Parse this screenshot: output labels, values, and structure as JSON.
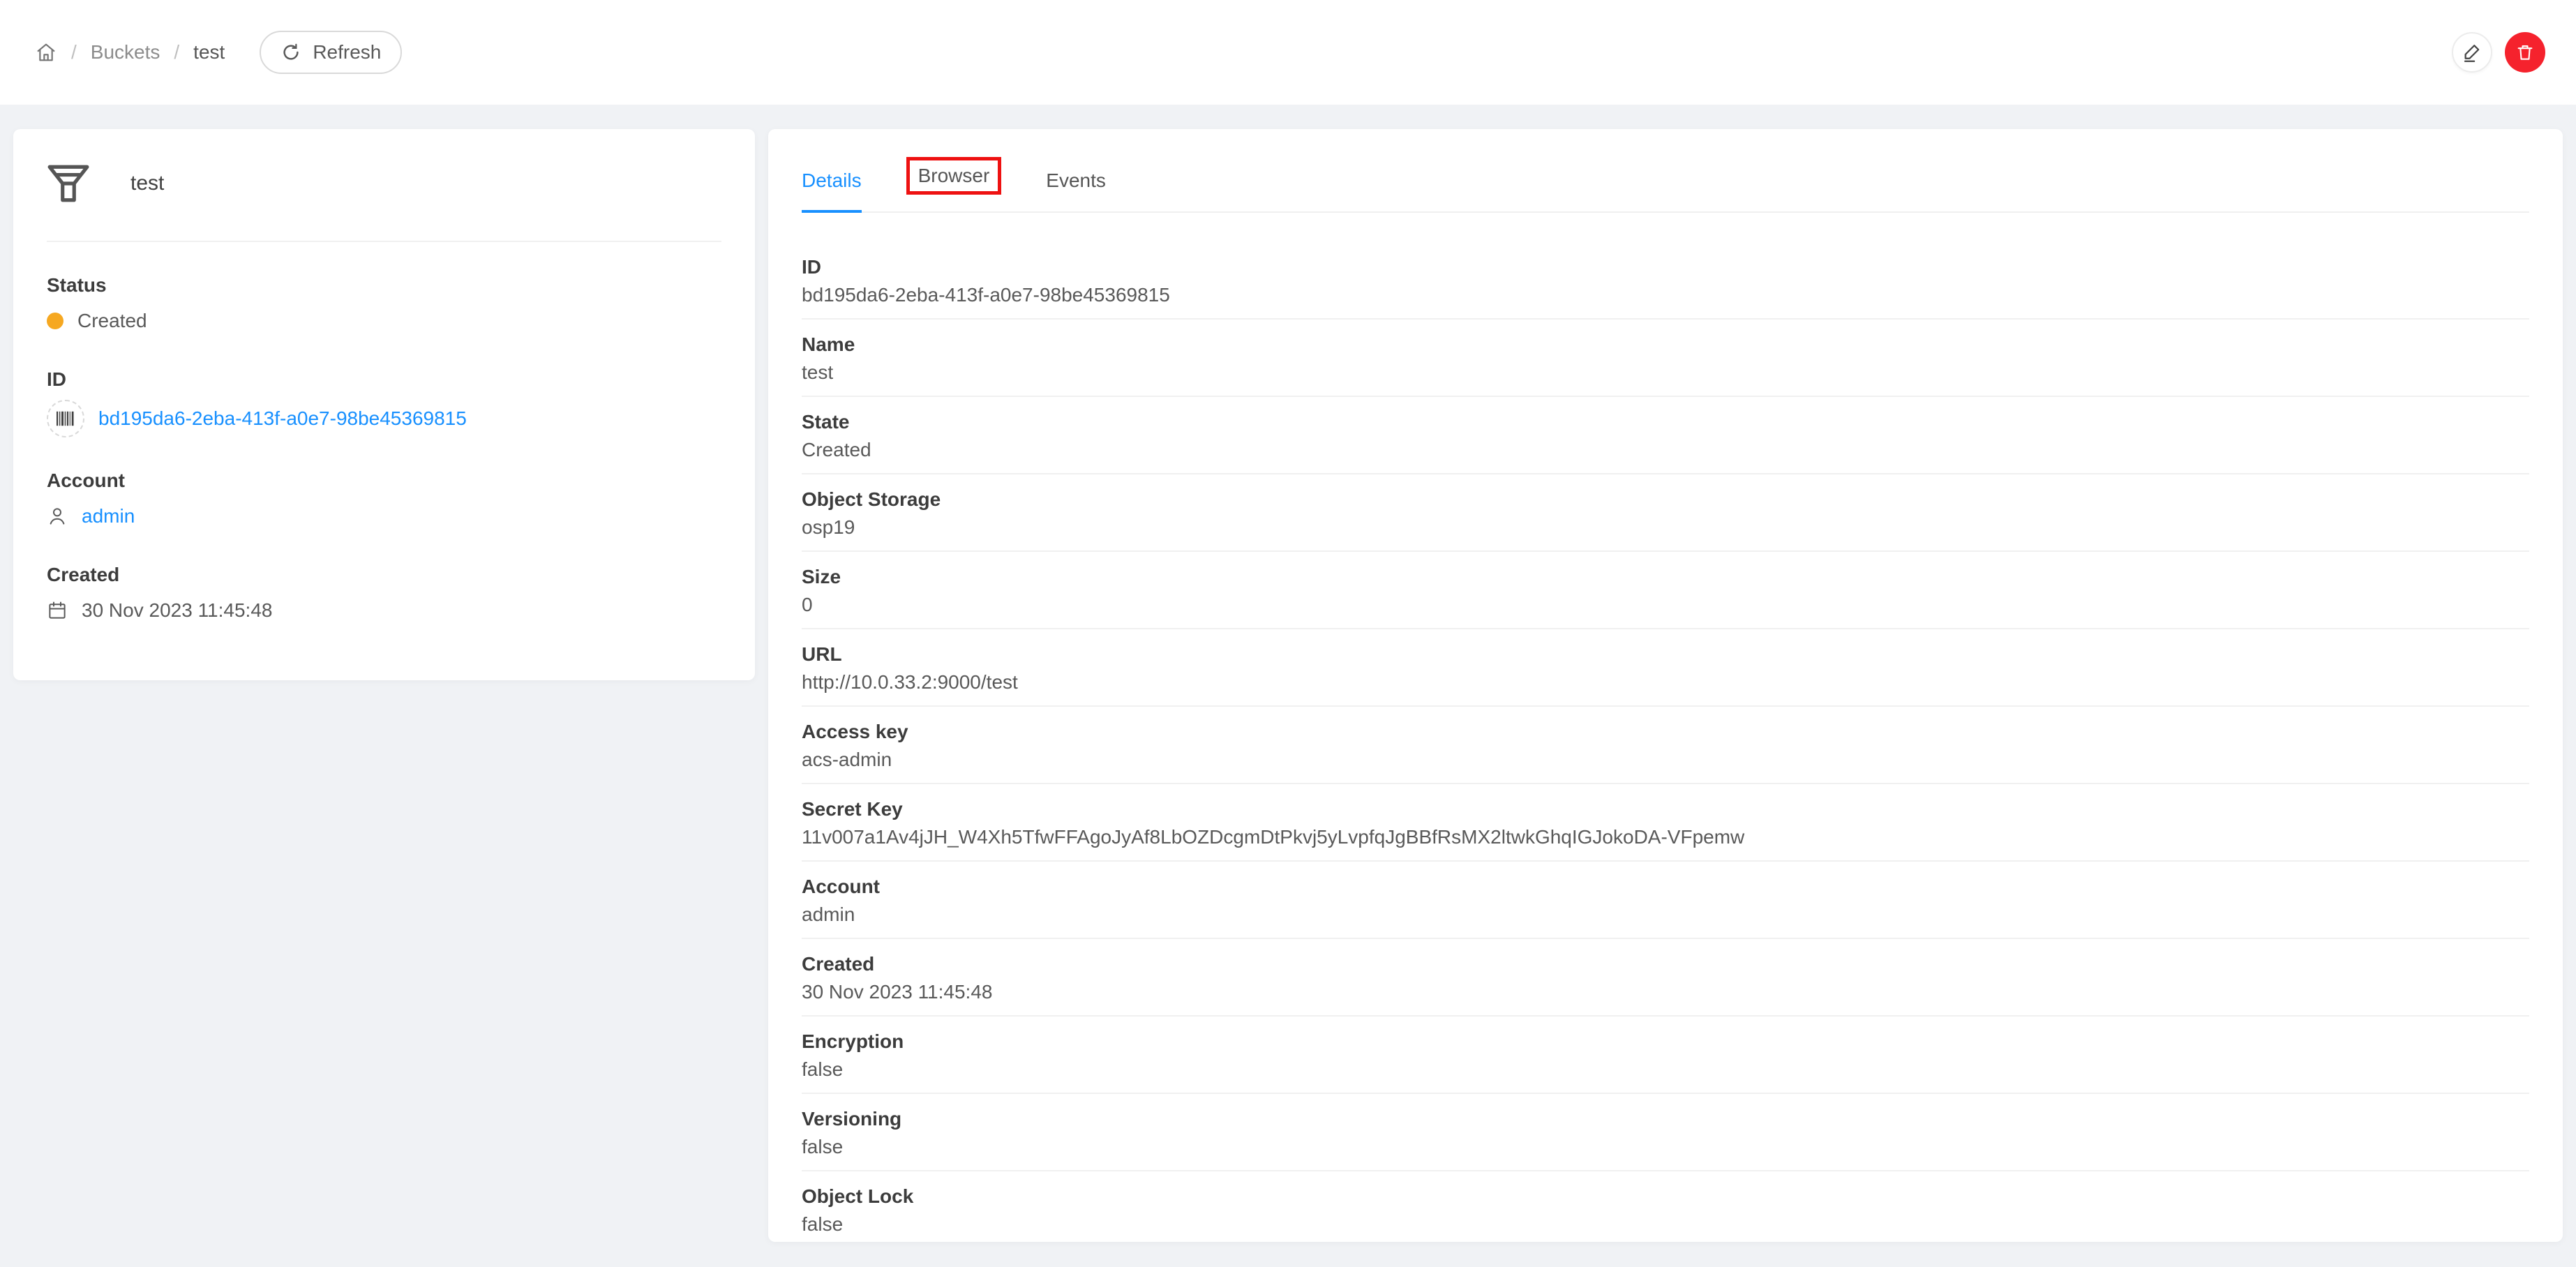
{
  "header": {
    "breadcrumb": {
      "home_icon": "home-icon",
      "separator": "/",
      "buckets_label": "Buckets",
      "current_label": "test"
    },
    "refresh_label": "Refresh",
    "actions": {
      "edit_icon": "pencil-icon",
      "delete_icon": "trash-icon"
    }
  },
  "info_card": {
    "resource_icon": "bucket-funnel-icon",
    "title": "test",
    "status": {
      "label": "Status",
      "value": "Created"
    },
    "id": {
      "label": "ID",
      "icon": "barcode-icon",
      "value": "bd195da6-2eba-413f-a0e7-98be45369815"
    },
    "account": {
      "label": "Account",
      "icon": "user-icon",
      "value": "admin"
    },
    "created": {
      "label": "Created",
      "icon": "calendar-icon",
      "value": "30 Nov 2023 11:45:48"
    }
  },
  "tabs": [
    {
      "label": "Details",
      "active": true,
      "annotated": false
    },
    {
      "label": "Browser",
      "active": false,
      "annotated": true
    },
    {
      "label": "Events",
      "active": false,
      "annotated": false
    }
  ],
  "details": {
    "fields": [
      {
        "label": "ID",
        "value": "bd195da6-2eba-413f-a0e7-98be45369815"
      },
      {
        "label": "Name",
        "value": "test"
      },
      {
        "label": "State",
        "value": "Created"
      },
      {
        "label": "Object Storage",
        "value": "osp19"
      },
      {
        "label": "Size",
        "value": "0"
      },
      {
        "label": "URL",
        "value": "http://10.0.33.2:9000/test"
      },
      {
        "label": "Access key",
        "value": "acs-admin"
      },
      {
        "label": "Secret Key",
        "value": "11v007a1Av4jJH_W4Xh5TfwFFAgoJyAf8LbOZDcgmDtPkvj5yLvpfqJgBBfRsMX2ltwkGhqIGJokoDA-VFpemw"
      },
      {
        "label": "Account",
        "value": "admin"
      },
      {
        "label": "Created",
        "value": "30 Nov 2023 11:45:48"
      },
      {
        "label": "Encryption",
        "value": "false"
      },
      {
        "label": "Versioning",
        "value": "false"
      },
      {
        "label": "Object Lock",
        "value": "false"
      }
    ]
  },
  "colors": {
    "accent_blue": "#1890ff",
    "status_created_dot": "#f6a821",
    "danger_red": "#f5222d",
    "annotation_red": "#ee1111",
    "page_background": "#f0f2f5"
  }
}
